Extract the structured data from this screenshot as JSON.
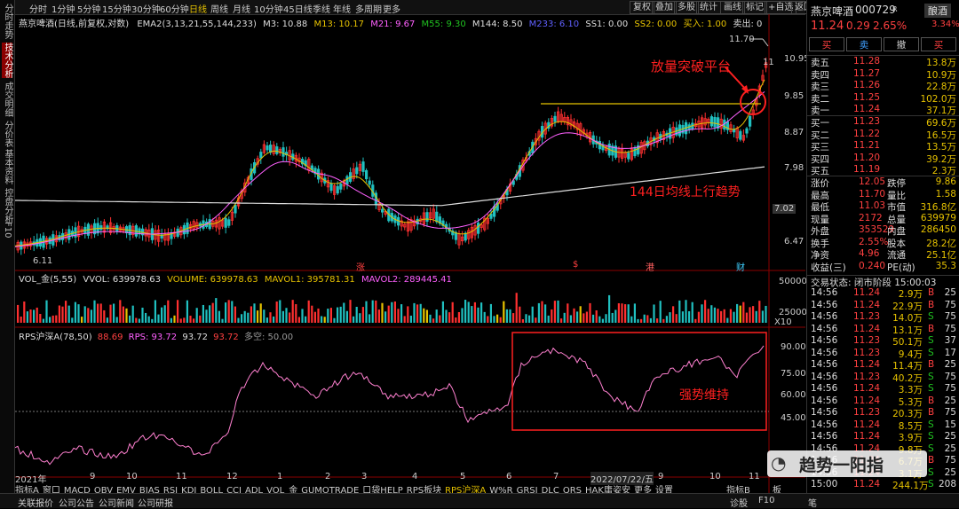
{
  "left_tabs": [
    "分时走势",
    "技术分析",
    "成交明细",
    "分价表",
    "基本资料",
    "控盘分析",
    "F10"
  ],
  "periods": [
    "分时",
    "1分钟",
    "5分钟",
    "15分钟",
    "30分钟",
    "60分钟",
    "日线",
    "周线",
    "月线",
    "10分钟",
    "45日线",
    "季线",
    "年线",
    "多周期",
    "更多"
  ],
  "toolbar_right": [
    "复权",
    "叠加",
    "多股",
    "统计",
    "画线",
    "标记",
    "+自选",
    "返回"
  ],
  "stock_title": "燕京啤酒(日线,前复权,对数)",
  "ma_indicator": {
    "name": "EMA2(3,13,21,55,144,233)",
    "m3": "M3: 10.88",
    "m13": "M13: 10.17",
    "m21": "M21: 9.67",
    "m55": "M55: 9.30",
    "m144": "M144: 8.50",
    "m233": "M233: 6.10",
    "ss1": "SS1: 0.00",
    "ss2": "SS2: 0.00",
    "buy": "买入: 1.00",
    "sell": "卖出: 0"
  },
  "price_axis": [
    "10.95",
    "9.85",
    "8.87",
    "7.98",
    "7.02",
    "6.47"
  ],
  "price_marks": {
    "high": "11.70",
    "low": "6.11",
    "tag": "11"
  },
  "markers": [
    "涨",
    "$",
    "港",
    "财"
  ],
  "vol_indicator": {
    "name": "VOL_金(5,55)",
    "vvol": "VVOL: 639978.63",
    "volume": "VOLUME: 639978.63",
    "mavol1": "MAVOL1: 395781.31",
    "mavol2": "MAVOL2: 289445.41"
  },
  "vol_axis": [
    "50000",
    "25000",
    "X10"
  ],
  "rps_indicator": {
    "name": "RPS沪深A(78,50)",
    "v1": "88.69",
    "rps": "RPS: 93.72",
    "v2": "93.72",
    "v3": "93.72",
    "line": "多空: 50.00"
  },
  "rps_axis": [
    "90.00",
    "75.00",
    "60.00",
    "45.00"
  ],
  "x_axis": [
    "2021年",
    "9",
    "10",
    "11",
    "12",
    "1",
    "2",
    "3",
    "4",
    "5",
    "6",
    "7",
    "2022/07/22/五",
    "9",
    "10",
    "11"
  ],
  "indicator_tabs": [
    "指标A",
    "窗口",
    "MACD",
    "OBV",
    "EMV",
    "BIAS",
    "RSI",
    "KDJ",
    "BOLL",
    "CCI",
    "ADL",
    "VOL_金",
    "GUMOTRADE",
    "口袋HELP",
    "RPS板块",
    "RPS沪深A",
    "W%R",
    "GRSI",
    "DLC",
    "QRS",
    "HAK庸姿安",
    "更多",
    "设置"
  ],
  "indicator_tabs_right": [
    "指标B",
    "板"
  ],
  "annotations": {
    "breakout": "放量突破平台",
    "ma144": "144日均线上行趋势",
    "strong": "强势维持"
  },
  "quote": {
    "name": "燕京啤酒",
    "code": "000729",
    "tag": "R",
    "sector": "酿酒",
    "price": "11.24",
    "change": "0.29",
    "pct": "2.65%",
    "ratio": "3.34%",
    "buttons": [
      "买",
      "卖",
      "撤",
      "买"
    ],
    "asks": [
      {
        "l": "卖五",
        "p": "11.28",
        "v": "13.8万"
      },
      {
        "l": "卖四",
        "p": "11.27",
        "v": "10.9万"
      },
      {
        "l": "卖三",
        "p": "11.26",
        "v": "22.8万"
      },
      {
        "l": "卖二",
        "p": "11.25",
        "v": "102.0万"
      },
      {
        "l": "卖一",
        "p": "11.24",
        "v": "37.1万"
      }
    ],
    "bids": [
      {
        "l": "买一",
        "p": "11.23",
        "v": "69.6万"
      },
      {
        "l": "买二",
        "p": "11.22",
        "v": "16.5万"
      },
      {
        "l": "买三",
        "p": "11.21",
        "v": "13.5万"
      },
      {
        "l": "买四",
        "p": "11.20",
        "v": "39.2万"
      },
      {
        "l": "买五",
        "p": "11.19",
        "v": "2.3万"
      }
    ],
    "stats": [
      {
        "a": "涨价",
        "av": "12.05",
        "b": "跌停",
        "bv": "9.86"
      },
      {
        "a": "最高",
        "av": "11.70",
        "b": "量比",
        "bv": "1.58"
      },
      {
        "a": "最低",
        "av": "11.03",
        "b": "市值",
        "bv": "316.8亿"
      },
      {
        "a": "现量",
        "av": "2172",
        "b": "总量",
        "bv": "639979"
      },
      {
        "a": "外盘",
        "av": "353529",
        "b": "内盘",
        "bv": "286450"
      },
      {
        "a": "换手",
        "av": "2.55%",
        "b": "股本",
        "bv": "28.2亿"
      },
      {
        "a": "净资",
        "av": "4.96",
        "b": "流通",
        "bv": "25.1亿"
      },
      {
        "a": "收益(三)",
        "av": "0.240",
        "b": "PE(动)",
        "bv": "35.3"
      }
    ],
    "trade_status": "交易状态: 闭市阶段 15:00:03",
    "ticks": [
      {
        "t": "14:56",
        "p": "11.24",
        "v": "2.9万",
        "d": "B",
        "n": "25"
      },
      {
        "t": "14:56",
        "p": "11.24",
        "v": "22.9万",
        "d": "B",
        "n": "75"
      },
      {
        "t": "14:56",
        "p": "11.23",
        "v": "14.0万",
        "d": "S",
        "n": "75"
      },
      {
        "t": "14:56",
        "p": "11.24",
        "v": "13.1万",
        "d": "B",
        "n": "75"
      },
      {
        "t": "14:56",
        "p": "11.23",
        "v": "50.1万",
        "d": "S",
        "n": "37"
      },
      {
        "t": "14:56",
        "p": "11.23",
        "v": "9.4万",
        "d": "S",
        "n": "17"
      },
      {
        "t": "14:56",
        "p": "11.24",
        "v": "11.4万",
        "d": "B",
        "n": "25"
      },
      {
        "t": "14:56",
        "p": "11.23",
        "v": "40.2万",
        "d": "S",
        "n": "75"
      },
      {
        "t": "14:56",
        "p": "11.24",
        "v": "3.3万",
        "d": "S",
        "n": "75"
      },
      {
        "t": "14:56",
        "p": "11.24",
        "v": "5.3万",
        "d": "B",
        "n": "25"
      },
      {
        "t": "14:56",
        "p": "11.23",
        "v": "20.3万",
        "d": "B",
        "n": "75"
      },
      {
        "t": "14:56",
        "p": "11.24",
        "v": "8.5万",
        "d": "S",
        "n": "15"
      },
      {
        "t": "14:56",
        "p": "11.24",
        "v": "3.9万",
        "d": "S",
        "n": "25"
      },
      {
        "t": "14:56",
        "p": "11.24",
        "v": "9.8万",
        "d": "S",
        "n": "25"
      },
      {
        "t": "14:56",
        "p": "11.24",
        "v": "6.7万",
        "d": "B",
        "n": "75"
      },
      {
        "t": "14:56",
        "p": "11.24",
        "v": "3.1万",
        "d": "S",
        "n": "25"
      },
      {
        "t": "15:00",
        "p": "11.24",
        "v": "244.1万",
        "d": "S",
        "n": "208"
      }
    ]
  },
  "bottom_tabs": [
    "关联报价",
    "公司公告",
    "公司新闻",
    "公司研报"
  ],
  "bottom_right": [
    "诊股",
    "F10",
    "笔"
  ],
  "watermark": "趋势一阳指"
}
